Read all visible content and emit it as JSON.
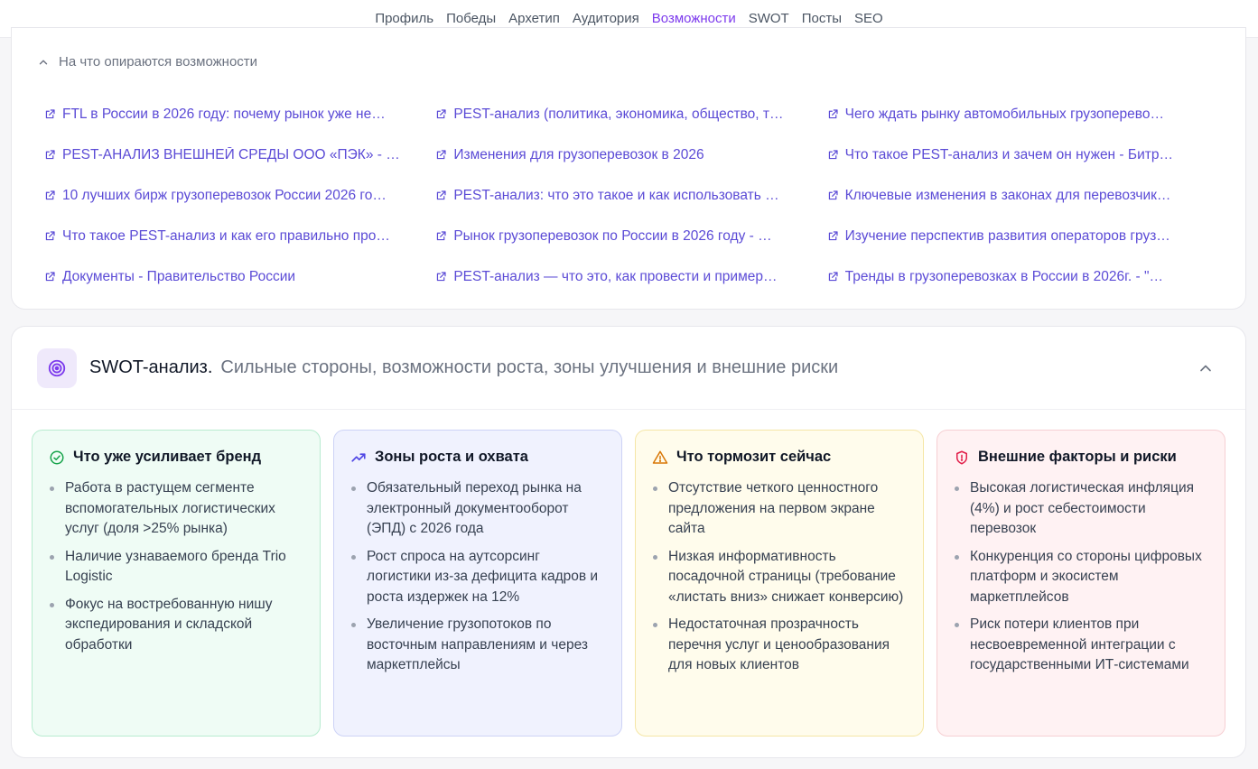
{
  "nav": {
    "items": [
      "Профиль",
      "Победы",
      "Архетип",
      "Аудитория",
      "Возможности",
      "SWOT",
      "Посты",
      "SEO"
    ],
    "active_index": 4,
    "accent_color": "#7c3aed"
  },
  "sources": {
    "toggle_label": "На что опираются возможности",
    "toggle_icon": "chevron-up-icon",
    "link_icon": "external-link-icon",
    "links": [
      [
        "FTL в России в 2026 году: почему рынок уже не…",
        "PEST-анализ (политика, экономика, общество, т…",
        "Чего ждать рынку автомобильных грузоперево…"
      ],
      [
        "PEST-АНАЛИЗ ВНЕШНЕЙ СРЕДЫ ООО «ПЭК» - …",
        "Изменения для грузоперевозок в 2026",
        "Что такое PEST-анализ и зачем он нужен - Битр…"
      ],
      [
        "10 лучших бирж грузоперевозок России 2026 го…",
        "PEST-анализ: что это такое и как использовать …",
        "Ключевые изменения в законах для перевозчик…"
      ],
      [
        "Что такое PEST-анализ и как его правильно про…",
        "Рынок грузоперевозок по России в 2026 году - …",
        "Изучение перспектив развития операторов груз…"
      ],
      [
        "Документы - Правительство России",
        "PEST-анализ — что это, как провести и пример…",
        "Тренды в грузоперевозках в России в 2026г. - \"…"
      ]
    ],
    "link_color": "#5b4bd6"
  },
  "swot": {
    "icon": "target-icon",
    "title": "SWOT-анализ.",
    "subtitle": "Сильные стороны, возможности роста, зоны улучшения и внешние риски",
    "collapse_icon": "chevron-up-icon",
    "quadrants": [
      {
        "icon": "check-circle-icon",
        "title": "Что уже усиливает бренд",
        "color": "#16a34a",
        "items": [
          "Работа в растущем сегменте вспомогательных логистических услуг (доля >25% рынка)",
          "Наличие узнаваемого бренда Trio Logistic",
          "Фокус на востребованную нишу экспедирования и складской обработки"
        ]
      },
      {
        "icon": "trending-up-icon",
        "title": "Зоны роста и охвата",
        "color": "#4f46e5",
        "items": [
          "Обязательный переход рынка на электронный документооборот (ЭПД) с 2026 года",
          "Рост спроса на аутсорсинг логистики из-за дефицита кадров и роста издержек на 12%",
          "Увеличение грузопотоков по восточным направлениям и через маркетплейсы"
        ]
      },
      {
        "icon": "warning-triangle-icon",
        "title": "Что тормозит сейчас",
        "color": "#d97706",
        "items": [
          "Отсутствие четкого ценностного предложения на первом экране сайта",
          "Низкая информативность посадочной страницы (требование «листать вниз» снижает конверсию)",
          "Недостаточная прозрачность перечня услуг и ценообразования для новых клиентов"
        ]
      },
      {
        "icon": "shield-alert-icon",
        "title": "Внешние факторы и риски",
        "color": "#e11d48",
        "items": [
          "Высокая логистическая инфляция (4%) и рост себестоимости перевозок",
          "Конкуренция со стороны цифровых платформ и экосистем маркетплейсов",
          "Риск потери клиентов при несвоевременной интеграции с государственными ИТ-системами"
        ]
      }
    ]
  }
}
